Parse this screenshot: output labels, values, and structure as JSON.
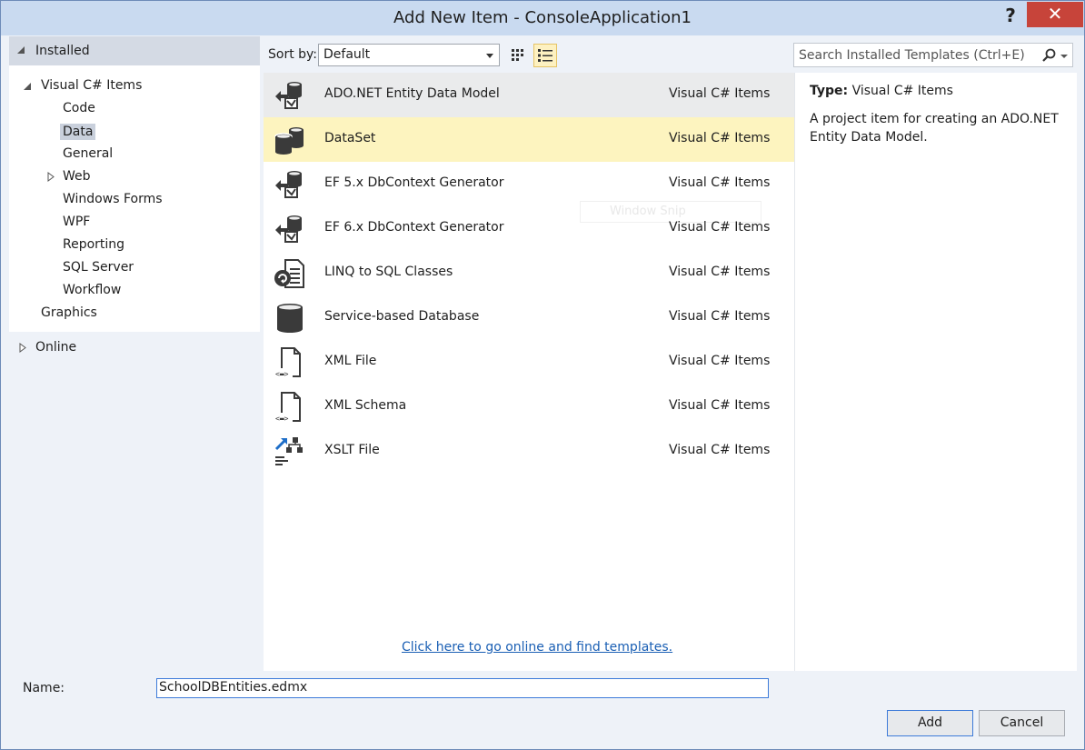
{
  "window": {
    "title": "Add New Item - ConsoleApplication1",
    "help_label": "?",
    "close_label": "✕"
  },
  "left": {
    "installed_label": "Installed",
    "tree": [
      {
        "label": "Visual C# Items",
        "expanded": true
      },
      {
        "label": "Code"
      },
      {
        "label": "Data",
        "selected": true
      },
      {
        "label": "General"
      },
      {
        "label": "Web",
        "collapsed": true
      },
      {
        "label": "Windows Forms"
      },
      {
        "label": "WPF"
      },
      {
        "label": "Reporting"
      },
      {
        "label": "SQL Server"
      },
      {
        "label": "Workflow"
      },
      {
        "label": "Graphics"
      }
    ],
    "online_label": "Online"
  },
  "toolbar": {
    "sort_label": "Sort by:",
    "sort_value": "Default",
    "search_placeholder": "Search Installed Templates (Ctrl+E)"
  },
  "items": [
    {
      "name": "ADO.NET Entity Data Model",
      "category": "Visual C# Items",
      "icon": "entity-model-icon",
      "state": "hovered"
    },
    {
      "name": "DataSet",
      "category": "Visual C# Items",
      "icon": "dataset-icon",
      "state": "selected"
    },
    {
      "name": "EF 5.x DbContext Generator",
      "category": "Visual C# Items",
      "icon": "entity-model-icon"
    },
    {
      "name": "EF 6.x DbContext Generator",
      "category": "Visual C# Items",
      "icon": "entity-model-icon"
    },
    {
      "name": "LINQ to SQL Classes",
      "category": "Visual C# Items",
      "icon": "linq-icon"
    },
    {
      "name": "Service-based Database",
      "category": "Visual C# Items",
      "icon": "database-icon"
    },
    {
      "name": "XML File",
      "category": "Visual C# Items",
      "icon": "xml-file-icon"
    },
    {
      "name": "XML Schema",
      "category": "Visual C# Items",
      "icon": "xml-file-icon"
    },
    {
      "name": "XSLT File",
      "category": "Visual C# Items",
      "icon": "xslt-icon"
    }
  ],
  "online_link": "Click here to go online and find templates.",
  "snip_ghost": "Window Snip",
  "description": {
    "type_label": "Type:",
    "type_value": "Visual C# Items",
    "text": "A project item for creating an ADO.NET Entity Data Model."
  },
  "bottom": {
    "name_label": "Name:",
    "name_value": "SchoolDBEntities.edmx",
    "add_label": "Add",
    "cancel_label": "Cancel"
  },
  "colors": {
    "selected_row": "#fdf4bf",
    "hover_row": "#eaebec",
    "link": "#1a5fb4",
    "close_button": "#c7443a"
  }
}
